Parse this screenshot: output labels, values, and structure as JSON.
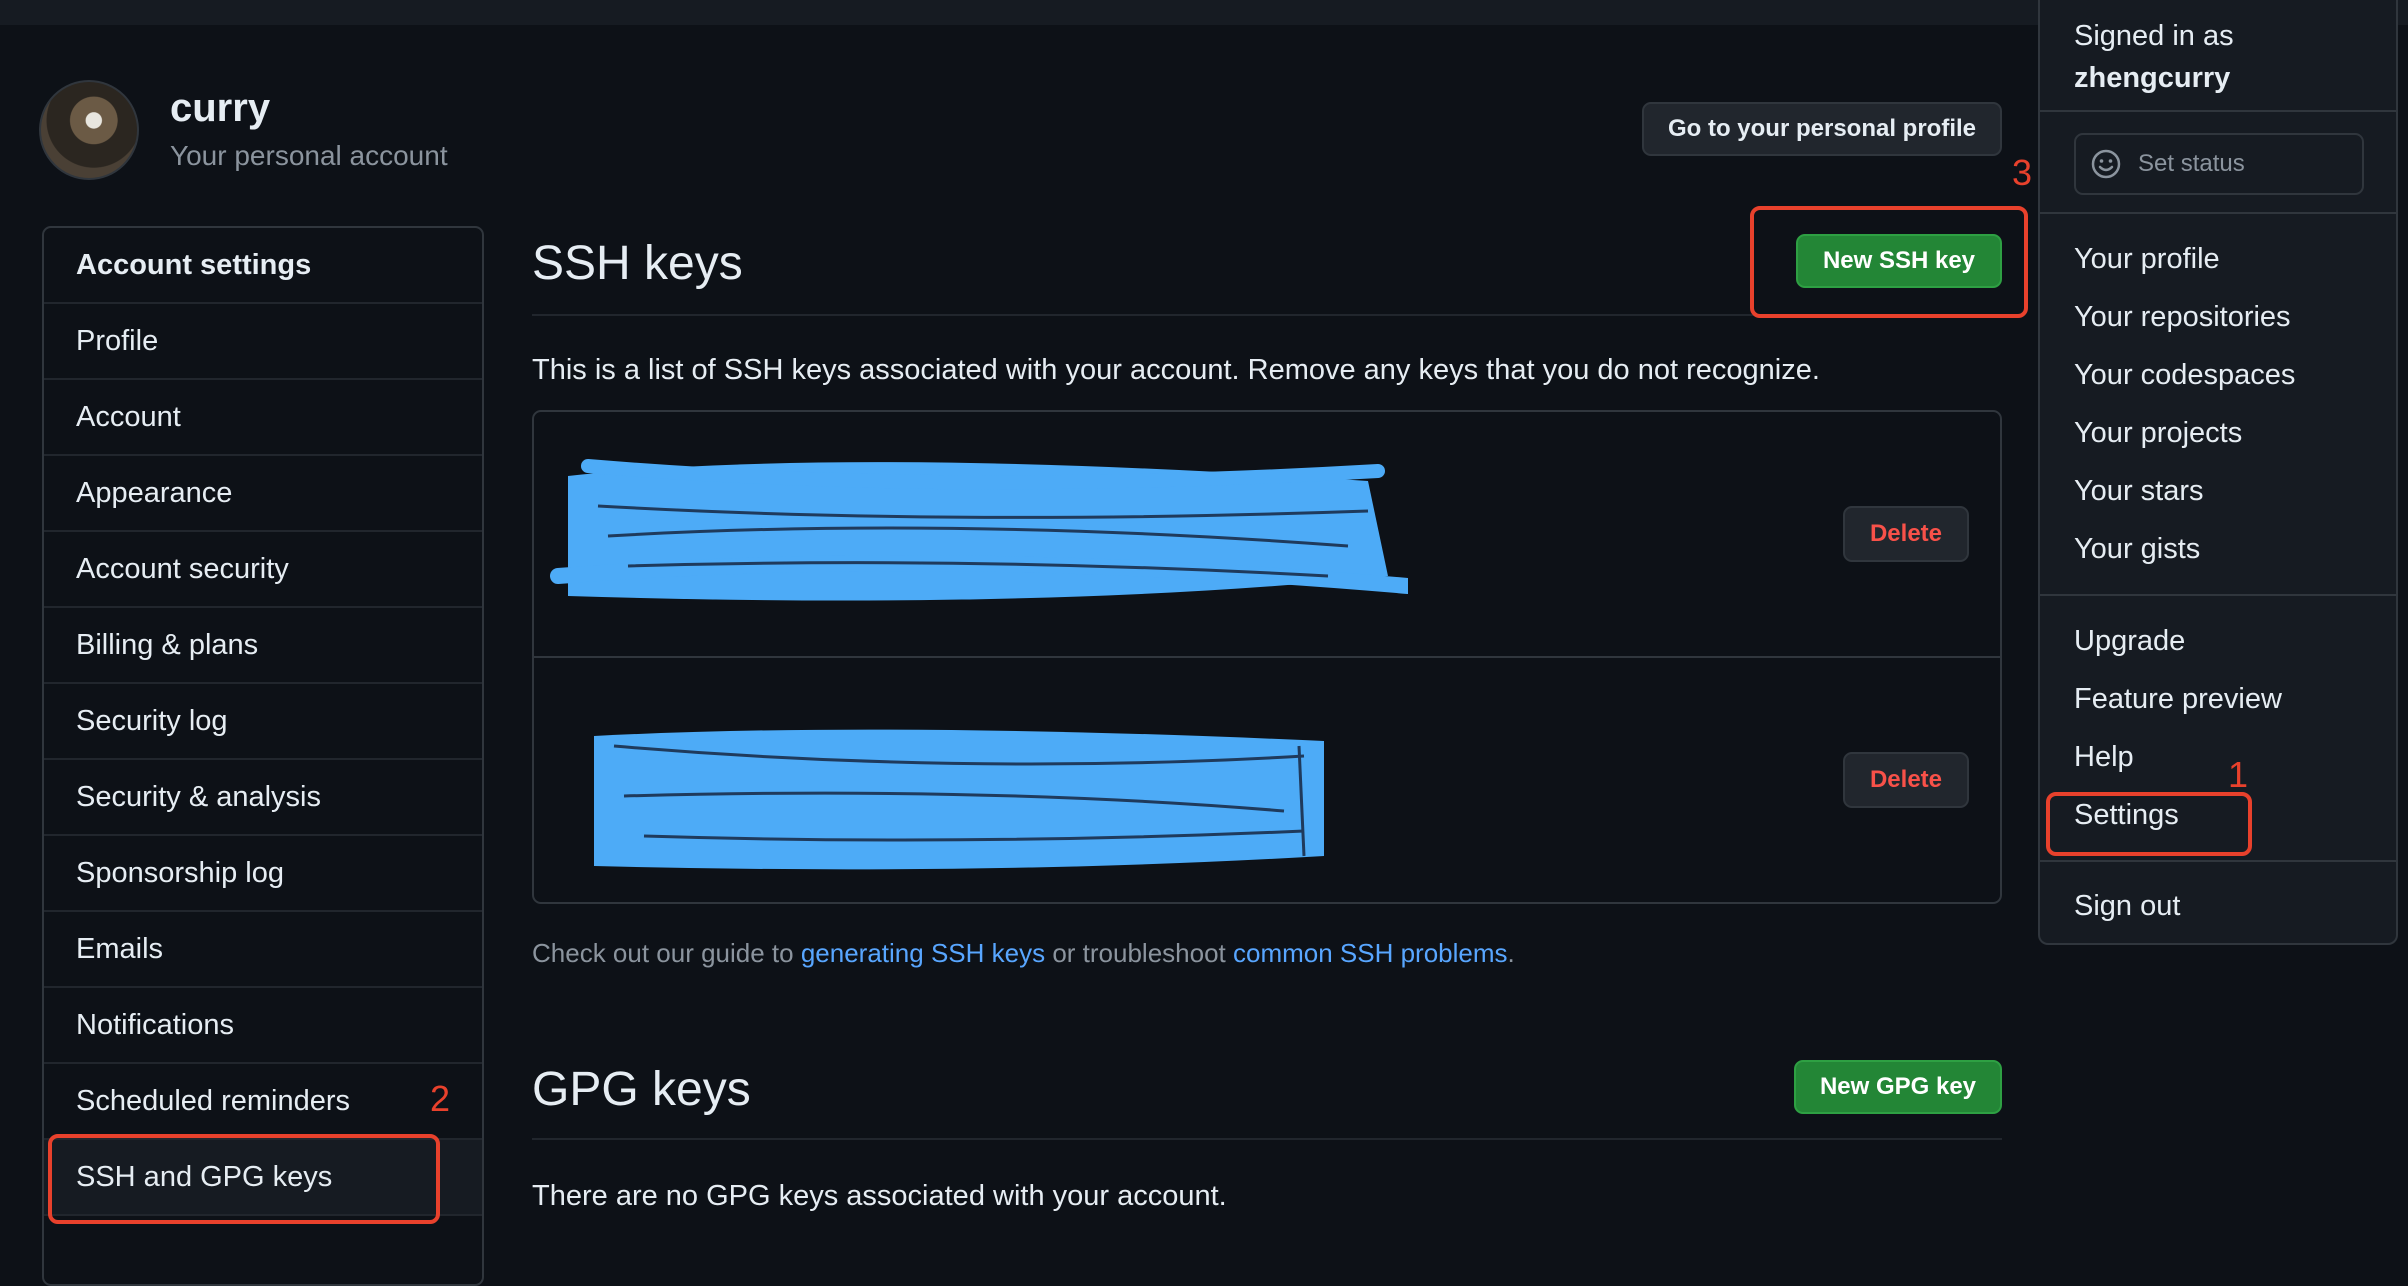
{
  "header": {
    "username": "curry",
    "subtitle": "Your personal account",
    "profile_button": "Go to your personal profile"
  },
  "sidebar": {
    "items": [
      {
        "label": "Account settings"
      },
      {
        "label": "Profile"
      },
      {
        "label": "Account"
      },
      {
        "label": "Appearance"
      },
      {
        "label": "Account security"
      },
      {
        "label": "Billing & plans"
      },
      {
        "label": "Security log"
      },
      {
        "label": "Security & analysis"
      },
      {
        "label": "Sponsorship log"
      },
      {
        "label": "Emails"
      },
      {
        "label": "Notifications"
      },
      {
        "label": "Scheduled reminders"
      },
      {
        "label": "SSH and GPG keys"
      }
    ]
  },
  "ssh": {
    "title": "SSH keys",
    "new_button": "New SSH key",
    "description": "This is a list of SSH keys associated with your account. Remove any keys that you do not recognize.",
    "keys": [
      {
        "delete_label": "Delete"
      },
      {
        "delete_label": "Delete"
      }
    ],
    "guide_prefix": "Check out our guide to ",
    "guide_link1": "generating SSH keys",
    "guide_middle": " or troubleshoot ",
    "guide_link2": "common SSH problems",
    "guide_suffix": "."
  },
  "gpg": {
    "title": "GPG keys",
    "new_button": "New GPG key",
    "empty_text": "There are no GPG keys associated with your account."
  },
  "dropdown": {
    "signed_in_as": "Signed in as",
    "username": "zhengcurry",
    "set_status": "Set status",
    "group1": [
      "Your profile",
      "Your repositories",
      "Your codespaces",
      "Your projects",
      "Your stars",
      "Your gists"
    ],
    "group2": [
      "Upgrade",
      "Feature preview",
      "Help",
      "Settings"
    ],
    "sign_out": "Sign out"
  },
  "annotations": {
    "one": "1",
    "two": "2",
    "three": "3"
  },
  "colors": {
    "background": "#0d1117",
    "panel": "#161b22",
    "green_button": "#238636",
    "danger_text": "#f85149",
    "link": "#58a6ff",
    "annotation_red": "#e8412c",
    "redaction_blue": "#4dabf7"
  },
  "icons": {
    "set_status": "smiley-icon"
  }
}
